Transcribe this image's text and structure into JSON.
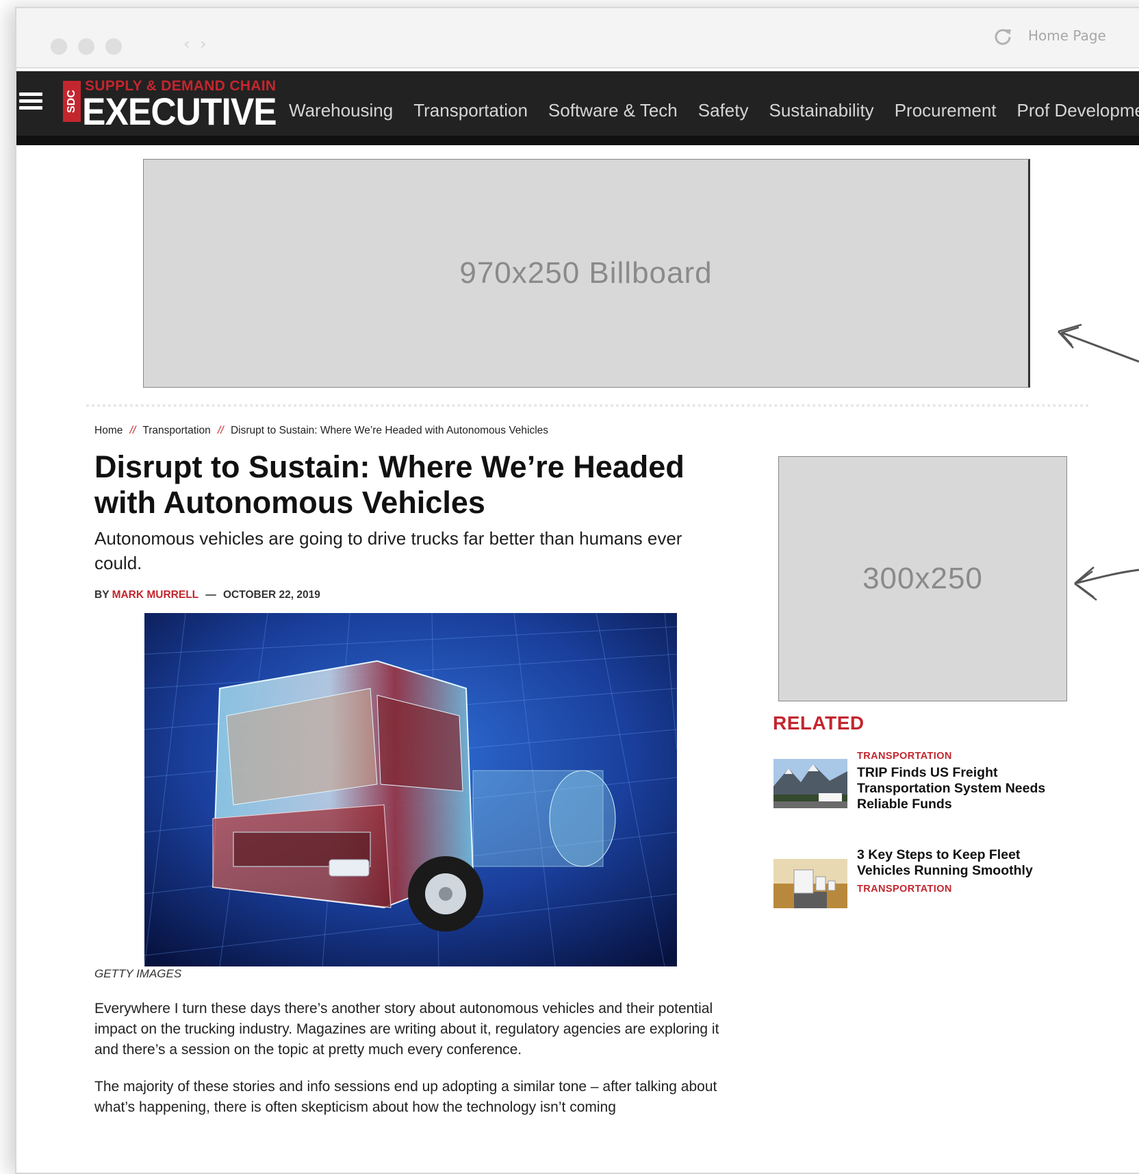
{
  "browser": {
    "home_label": "Home Page",
    "back_glyph": "‹",
    "forward_glyph": "›",
    "icons": [
      "window-dot-icon",
      "reload-icon"
    ]
  },
  "site": {
    "logo_top": "SUPPLY & DEMAND CHAIN",
    "logo_main": "EXECUTIVE",
    "logo_badge": "SDC",
    "nav": [
      "Warehousing",
      "Transportation",
      "Software & Tech",
      "Safety",
      "Sustainability",
      "Procurement",
      "Prof Development"
    ]
  },
  "ads": {
    "billboard": "970x250 Billboard",
    "mrec": "300x250"
  },
  "breadcrumb": {
    "home": "Home",
    "separator": "//",
    "category": "Transportation",
    "current": "Disrupt to Sustain: Where We’re Headed with Autonomous Vehicles"
  },
  "article": {
    "title": "Disrupt to Sustain: Where We’re Headed with Autonomous Vehicles",
    "subtitle": "Autonomous vehicles are going to drive trucks far better than humans ever could.",
    "by": "BY",
    "author": "MARK MURRELL",
    "dash": "—",
    "date": "OCTOBER 22, 2019",
    "image_caption": "GETTY IMAGES",
    "paragraphs": [
      "Everywhere I turn these days there’s another story about autonomous vehicles and their potential impact on the trucking industry. Magazines are writing about it, regulatory agencies are exploring it and there’s a session on the topic at pretty much every conference.",
      "The majority of these stories and info sessions end up adopting a similar tone – after talking about what’s happening, there is often skepticism about how the technology isn’t coming"
    ]
  },
  "related": {
    "heading": "RELATED",
    "items": [
      {
        "category": "TRANSPORTATION",
        "title": "TRIP Finds US Freight Transportation System Needs Reliable Funds"
      },
      {
        "category": "TRANSPORTATION",
        "title": "3 Key Steps to Keep Fleet Vehicles Running Smoothly"
      }
    ]
  },
  "colors": {
    "brand_red": "#c4262e",
    "nav_bg": "#222222",
    "ad_gray": "#d8d8d8"
  }
}
